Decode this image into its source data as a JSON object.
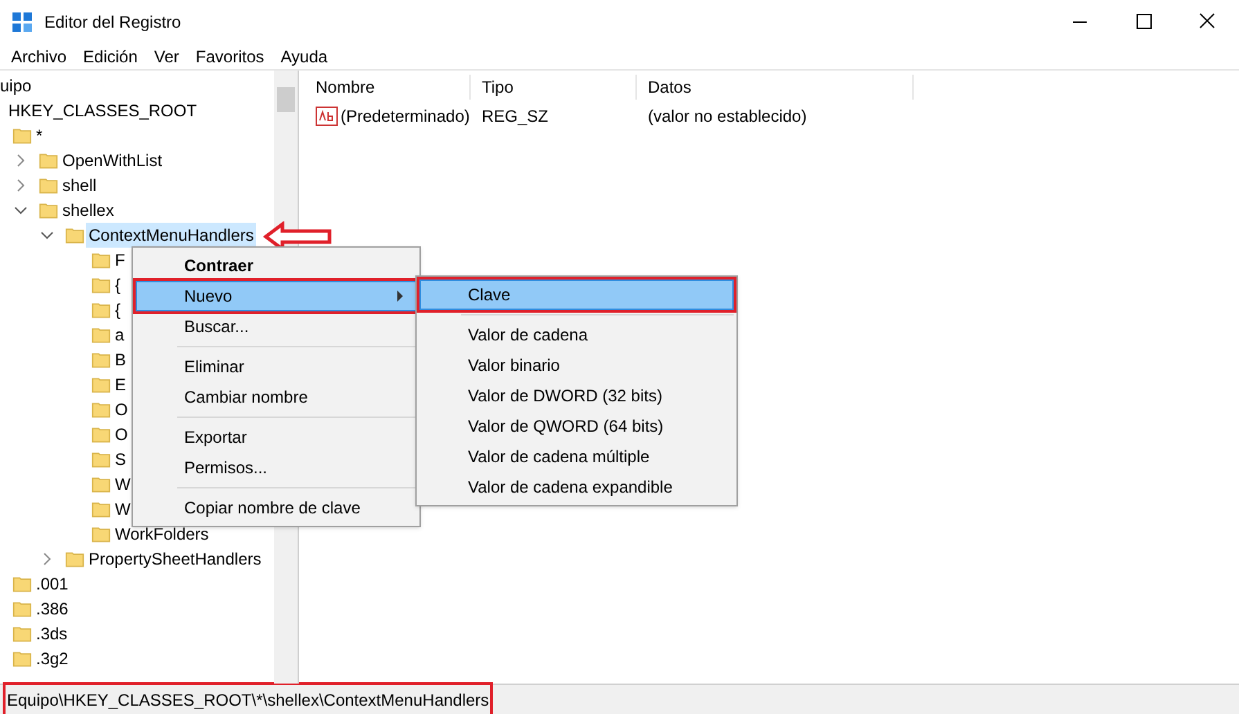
{
  "window": {
    "title": "Editor del Registro"
  },
  "menu": [
    "Archivo",
    "Edición",
    "Ver",
    "Favoritos",
    "Ayuda"
  ],
  "tree": {
    "header": "uipo",
    "root": "HKEY_CLASSES_ROOT",
    "items": [
      {
        "label": "*",
        "children": [
          {
            "label": "OpenWithList",
            "expanded": false
          },
          {
            "label": "shell",
            "expanded": false
          },
          {
            "label": "shellex",
            "expanded": true,
            "children": [
              {
                "label": "ContextMenuHandlers",
                "expanded": true,
                "selected": true,
                "children": [
                  {
                    "label": "F"
                  },
                  {
                    "label": "{"
                  },
                  {
                    "label": "{"
                  },
                  {
                    "label": "a"
                  },
                  {
                    "label": "B"
                  },
                  {
                    "label": "E"
                  },
                  {
                    "label": "O"
                  },
                  {
                    "label": "O"
                  },
                  {
                    "label": "S"
                  },
                  {
                    "label": "W"
                  },
                  {
                    "label": "W"
                  },
                  {
                    "label": "WorkFolders"
                  }
                ]
              },
              {
                "label": "PropertySheetHandlers",
                "expanded": false
              }
            ]
          }
        ]
      },
      {
        "label": ".001"
      },
      {
        "label": ".386"
      },
      {
        "label": ".3ds"
      },
      {
        "label": ".3g2"
      }
    ]
  },
  "table": {
    "columns": [
      "Nombre",
      "Tipo",
      "Datos"
    ],
    "rows": [
      [
        "(Predeterminado)",
        "REG_SZ",
        "(valor no establecido)"
      ]
    ]
  },
  "context_menu": [
    {
      "label": "Contraer",
      "kind": "bold"
    },
    {
      "label": "Nuevo",
      "kind": "submenu",
      "selected": true
    },
    {
      "label": "Buscar...",
      "kind": "item"
    },
    {
      "kind": "separator"
    },
    {
      "label": "Eliminar",
      "kind": "item"
    },
    {
      "label": "Cambiar nombre",
      "kind": "item"
    },
    {
      "kind": "separator"
    },
    {
      "label": "Exportar",
      "kind": "item"
    },
    {
      "label": "Permisos...",
      "kind": "item"
    },
    {
      "kind": "separator"
    },
    {
      "label": "Copiar nombre de clave",
      "kind": "item"
    }
  ],
  "submenu": [
    {
      "label": "Clave",
      "selected": true
    },
    {
      "kind": "separator"
    },
    {
      "label": "Valor de cadena",
      "selected": false
    },
    {
      "label": "Valor binario",
      "selected": false
    },
    {
      "label": "Valor de DWORD (32 bits)",
      "selected": false
    },
    {
      "label": "Valor de QWORD (64 bits)",
      "selected": false
    },
    {
      "label": "Valor de cadena múltiple",
      "selected": false
    },
    {
      "label": "Valor de cadena expandible",
      "selected": false
    }
  ],
  "status_bar": "Equipo\\HKEY_CLASSES_ROOT\\*\\shellex\\ContextMenuHandlers"
}
